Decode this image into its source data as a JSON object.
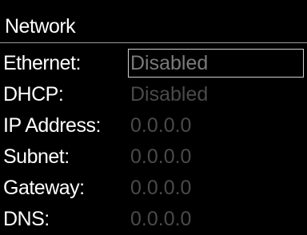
{
  "header": {
    "title": "Network"
  },
  "fields": [
    {
      "label": "Ethernet:",
      "value": "Disabled"
    },
    {
      "label": "DHCP:",
      "value": "Disabled"
    },
    {
      "label": "IP Address:",
      "value": "0.0.0.0"
    },
    {
      "label": "Subnet:",
      "value": "0.0.0.0"
    },
    {
      "label": "Gateway:",
      "value": "0.0.0.0"
    },
    {
      "label": "DNS:",
      "value": "0.0.0.0"
    }
  ],
  "colors": {
    "background": "#000000",
    "label_text": "#ffffff",
    "value_text_disabled": "#4a4a4a",
    "selection_border": "#cfcfcf"
  }
}
